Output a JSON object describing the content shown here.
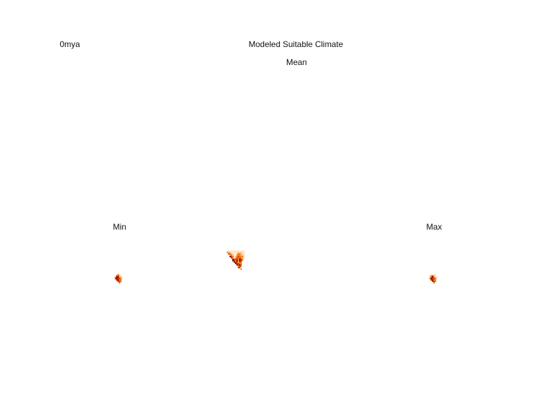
{
  "chart_data": {
    "type": "heatmap",
    "time_label": "0mya",
    "title": "Modeled Suitable Climate",
    "panels": [
      {
        "id": "mean",
        "label": "Mean",
        "cell_size": 2,
        "rows": [
          "1111111111111",
          "3221111121211",
          "0432110233211",
          "0033210333221",
          "0054312343331",
          "0004312434321",
          "0000544435430",
          "0000543535420",
          "0000054424300",
          "0000005443300",
          "0000000545300",
          "0000000034300",
          "0000000044000",
          "0000000000300"
        ]
      },
      {
        "id": "min",
        "label": "Min",
        "cell_size": 2,
        "rows": [
          "00131000",
          "01442100",
          "03553210",
          "04544310",
          "00453300",
          "00044300",
          "00003000"
        ]
      },
      {
        "id": "max",
        "label": "Max",
        "cell_size": 2,
        "rows": [
          "00111100",
          "01342100",
          "02453210",
          "03544310",
          "00453300",
          "00044300",
          "00003000"
        ]
      }
    ],
    "colors": [
      "#ffffff",
      "#fde8cf",
      "#fdbe6a",
      "#f58220",
      "#d43d0c",
      "#7a1206"
    ]
  }
}
